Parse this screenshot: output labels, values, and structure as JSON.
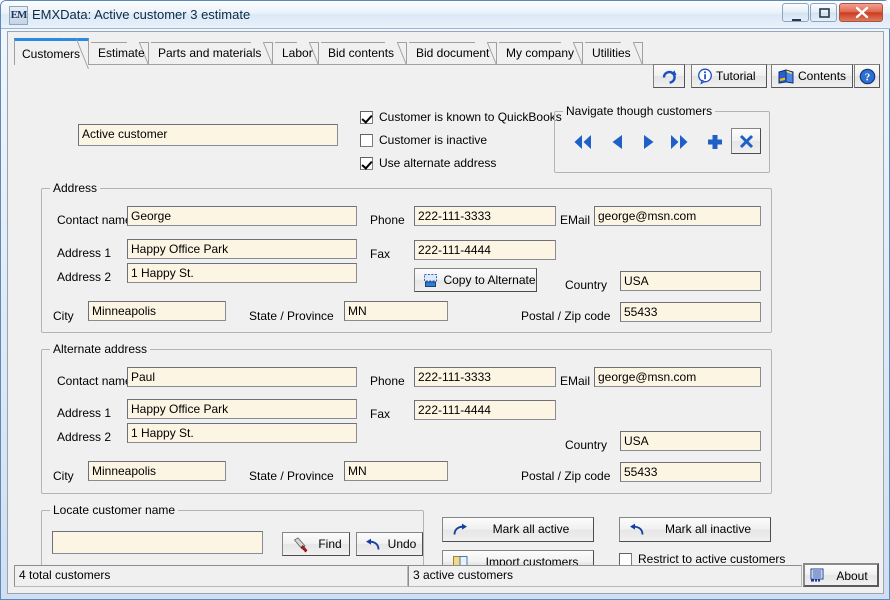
{
  "window": {
    "app_icon_text": "EM",
    "title": "EMXData:  Active customer 3 estimate",
    "minimize_glyph": "–",
    "maximize_glyph": "□",
    "close_glyph": "✕"
  },
  "tabs": [
    {
      "label": "Customers",
      "active": true
    },
    {
      "label": "Estimate",
      "active": false
    },
    {
      "label": "Parts and materials",
      "active": false
    },
    {
      "label": "Labor",
      "active": false
    },
    {
      "label": "Bid contents",
      "active": false
    },
    {
      "label": "Bid document",
      "active": false
    },
    {
      "label": "My company",
      "active": false
    },
    {
      "label": "Utilities",
      "active": false
    }
  ],
  "toolbar": {
    "refresh_label": "",
    "tutorial_label": "Tutorial",
    "contents_label": "Contents",
    "help_label": ""
  },
  "top": {
    "customer_name_value": "Active customer",
    "checkboxes": [
      {
        "label": "Customer is known to QuickBooks",
        "checked": true
      },
      {
        "label": "Customer is inactive",
        "checked": false
      },
      {
        "label": "Use alternate address",
        "checked": true
      }
    ],
    "navigate_legend": "Navigate though customers",
    "nav_buttons": [
      {
        "name": "first",
        "glyph": "◀◀"
      },
      {
        "name": "previous",
        "glyph": "◀"
      },
      {
        "name": "next",
        "glyph": "▶"
      },
      {
        "name": "last",
        "glyph": "▶▶"
      },
      {
        "name": "add",
        "glyph": "+"
      },
      {
        "name": "delete",
        "glyph": "✕"
      }
    ]
  },
  "address": {
    "legend": "Address",
    "contact_name_label": "Contact name",
    "contact_name_value": "George",
    "address1_label": "Address 1",
    "address1_value": "Happy Office Park",
    "address2_label": "Address 2",
    "address2_value": "1 Happy St.",
    "city_label": "City",
    "city_value": "Minneapolis",
    "state_label": "State / Province",
    "state_value": "MN",
    "phone_label": "Phone",
    "phone_value": "222-111-3333",
    "fax_label": "Fax",
    "fax_value": "222-111-4444",
    "email_label": "EMail",
    "email_value": "george@msn.com",
    "country_label": "Country",
    "country_value": "USA",
    "postal_label": "Postal / Zip code",
    "postal_value": "55433",
    "copy_button_label": "Copy to Alternate"
  },
  "alternate_address": {
    "legend": "Alternate address",
    "contact_name_label": "Contact name",
    "contact_name_value": "Paul",
    "address1_label": "Address 1",
    "address1_value": "Happy Office Park",
    "address2_label": "Address 2",
    "address2_value": "1 Happy St.",
    "city_label": "City",
    "city_value": "Minneapolis",
    "state_label": "State / Province",
    "state_value": "MN",
    "phone_label": "Phone",
    "phone_value": "222-111-3333",
    "fax_label": "Fax",
    "fax_value": "222-111-4444",
    "email_label": "EMail",
    "email_value": "george@msn.com",
    "country_label": "Country",
    "country_value": "USA",
    "postal_label": "Postal / Zip code",
    "postal_value": "55433"
  },
  "locate": {
    "legend": "Locate customer name",
    "search_value": "",
    "find_label": "Find",
    "undo_label": "Undo"
  },
  "actions": {
    "mark_all_active_label": "Mark all active",
    "mark_all_inactive_label": "Mark all inactive",
    "import_customers_label": "Import customers",
    "restrict_label": "Restrict to active customers",
    "restrict_checked": false
  },
  "statusbar": {
    "total_customers": "4 total customers",
    "active_customers": "3 active customers",
    "about_label": "About"
  },
  "colors": {
    "accent_blue": "#1a5fc8",
    "field_bg": "#fdf5e3",
    "window_bg": "#f0f0f0",
    "active_tab_top": "#2a8ae0",
    "close_red": "#cb3c22"
  }
}
